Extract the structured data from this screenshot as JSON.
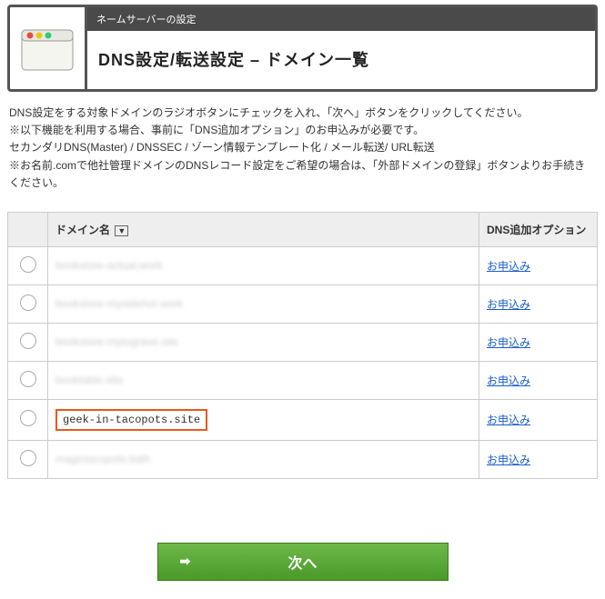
{
  "header": {
    "breadcrumb": "ネームサーバーの設定",
    "title": "DNS設定/転送設定 – ドメイン一覧"
  },
  "description": {
    "line1": "DNS設定をする対象ドメインのラジオボタンにチェックを入れ、「次へ」ボタンをクリックしてください。",
    "line2": "※以下機能を利用する場合、事前に「DNS追加オプション」のお申込みが必要です。",
    "line3": "セカンダリDNS(Master) / DNSSEC / ゾーン情報テンプレート化 / メール転送/ URL転送",
    "line4": "※お名前.comで他社管理ドメインのDNSレコード設定をご希望の場合は、「外部ドメインの登録」ボタンよりお手続きください。"
  },
  "table": {
    "headers": {
      "domain": "ドメイン名",
      "option": "DNS追加オプション"
    },
    "rows": [
      {
        "domain": "bookstore-actual.work",
        "blurred": true,
        "option_link": "お申込み"
      },
      {
        "domain": "bookstore-mysidehot.work",
        "blurred": true,
        "option_link": "お申込み"
      },
      {
        "domain": "bookstore-mytograve.site",
        "blurred": true,
        "option_link": "お申込み"
      },
      {
        "domain": "booktable.site",
        "blurred": true,
        "option_link": "お申込み"
      },
      {
        "domain": "geek-in-tacopots.site",
        "blurred": false,
        "highlighted": true,
        "option_link": "お申込み"
      },
      {
        "domain": "magictacopots.bath",
        "blurred": true,
        "option_link": "お申込み"
      }
    ]
  },
  "button": {
    "next": "次へ"
  }
}
